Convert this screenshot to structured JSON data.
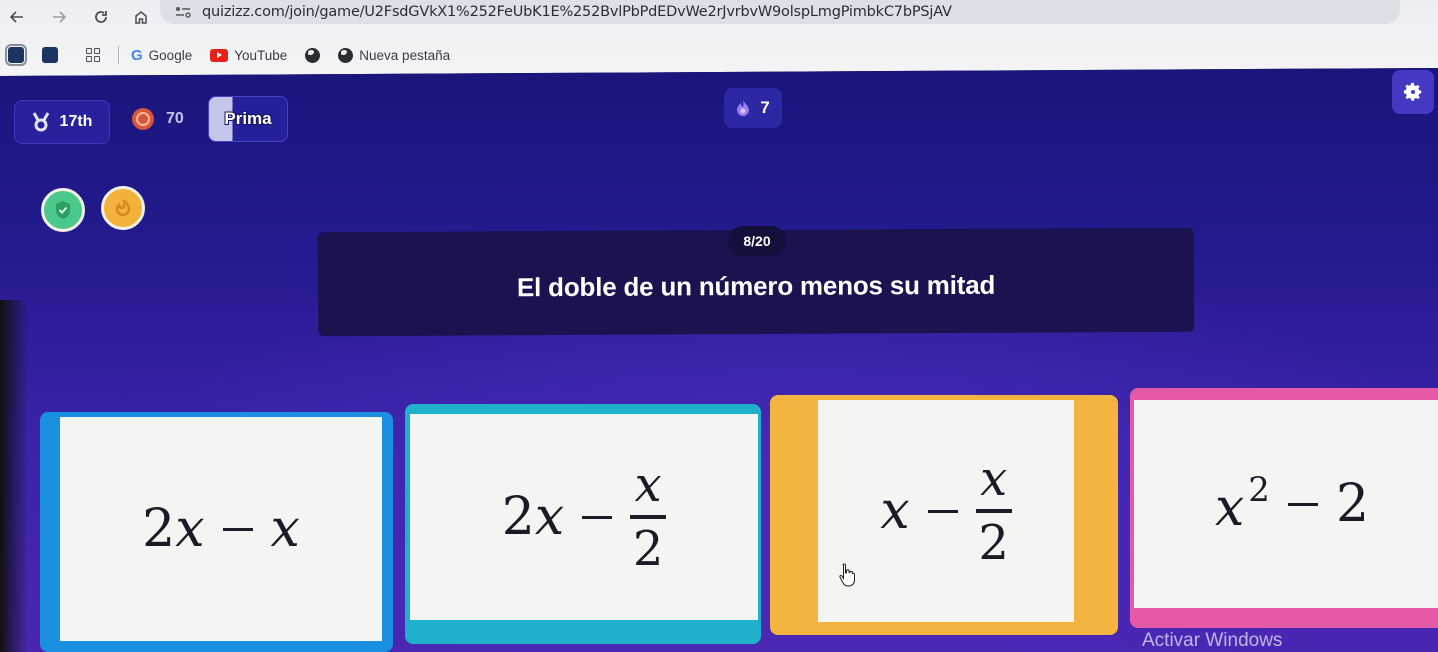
{
  "browser": {
    "nav": {
      "back_icon": "arrow-left-icon",
      "forward_icon": "arrow-right-icon",
      "reload_icon": "reload-icon",
      "home_icon": "home-icon"
    },
    "url": "quizizz.com/join/game/U2FsdGVkX1%252FeUbK1E%252BvlPbPdEDvWe2rJvrbvW9olspLmgPimbkC7bPSjAV",
    "bookmarks": [
      {
        "label": "Google",
        "icon": "google-icon"
      },
      {
        "label": "YouTube",
        "icon": "youtube-icon"
      },
      {
        "label": "",
        "icon": "globe-icon"
      },
      {
        "label": "Nueva pestaña",
        "icon": "globe-icon"
      }
    ]
  },
  "game": {
    "rank": "17th",
    "score": "70",
    "player_name": "Prima",
    "streak": "7",
    "powerups": [
      {
        "name": "shield",
        "color": "#4bc98c"
      },
      {
        "name": "streak-saver",
        "color": "#f2b13b"
      }
    ],
    "question_counter": "8/20",
    "question_text": "El doble de un número menos su mitad",
    "answers": [
      {
        "expression": "2x − x",
        "parts": {
          "coef": "2",
          "var1": "x",
          "var2": "x"
        },
        "color": "#1b8fe0"
      },
      {
        "expression": "2x − x/2",
        "parts": {
          "coef": "2",
          "var1": "x",
          "num": "x",
          "den": "2"
        },
        "color": "#1fb0cc"
      },
      {
        "expression": "x − x/2",
        "parts": {
          "var1": "x",
          "num": "x",
          "den": "2"
        },
        "color": "#f3b53f"
      },
      {
        "expression": "x² − 2",
        "parts": {
          "base": "x",
          "exp": "2",
          "const": "2"
        },
        "color": "#e45aa6"
      }
    ]
  },
  "os": {
    "watermark": "Activar Windows"
  }
}
